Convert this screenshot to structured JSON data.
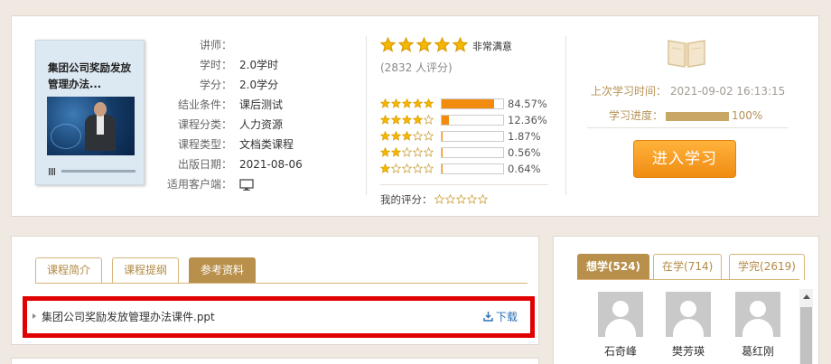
{
  "course": {
    "cover_title": "集团公司奖励发放管理办法...",
    "info": [
      {
        "label": "讲师：",
        "value": ""
      },
      {
        "label": "学时：",
        "value": "2.0学时"
      },
      {
        "label": "学分：",
        "value": "2.0学分"
      },
      {
        "label": "结业条件：",
        "value": "课后测试"
      },
      {
        "label": "课程分类：",
        "value": "人力资源"
      },
      {
        "label": "课程类型：",
        "value": "文档类课程"
      },
      {
        "label": "出版日期：",
        "value": "2021-08-06"
      },
      {
        "label": "适用客户端：",
        "value": ""
      }
    ],
    "client_icon": "monitor-icon"
  },
  "rating": {
    "stars": 5,
    "word": "非常满意",
    "count_text": "(2832 人评分)",
    "distribution": [
      {
        "stars": 5,
        "pct_text": "84.57%",
        "fraction": 0.8457
      },
      {
        "stars": 4,
        "pct_text": "12.36%",
        "fraction": 0.1236
      },
      {
        "stars": 3,
        "pct_text": "1.87%",
        "fraction": 0.0187
      },
      {
        "stars": 2,
        "pct_text": "0.56%",
        "fraction": 0.0056
      },
      {
        "stars": 1,
        "pct_text": "0.64%",
        "fraction": 0.0064
      }
    ],
    "my_rating_label": "我的评分：",
    "my_rating_stars": 0
  },
  "study": {
    "icon": "book-icon",
    "last_time_label": "上次学习时间：",
    "last_time_value": "2021-09-02 16:13:15",
    "progress_label": "学习进度：",
    "progress_value": "100%",
    "progress_fraction": 1.0,
    "enter_button": "进入学习"
  },
  "tabs": [
    {
      "label": "课程简介",
      "active": false
    },
    {
      "label": "课程提纲",
      "active": false
    },
    {
      "label": "参考资料",
      "active": true
    }
  ],
  "attachment": {
    "file_name": "集团公司奖励发放管理办法课件.ppt",
    "download_label": "下载"
  },
  "learner_tabs": [
    {
      "label": "想学",
      "count": "(524)",
      "active": true
    },
    {
      "label": "在学",
      "count": "(714)",
      "active": false
    },
    {
      "label": "学完",
      "count": "(2619)",
      "active": false
    }
  ],
  "learners": [
    {
      "name": "石奇峰"
    },
    {
      "name": "樊芳瑛"
    },
    {
      "name": "葛红刚"
    }
  ],
  "colors": {
    "accent": "#b8904c",
    "star": "#f5b800",
    "bar": "#f18c0f",
    "button": "#f39a1f",
    "highlight_border": "#e00000"
  }
}
